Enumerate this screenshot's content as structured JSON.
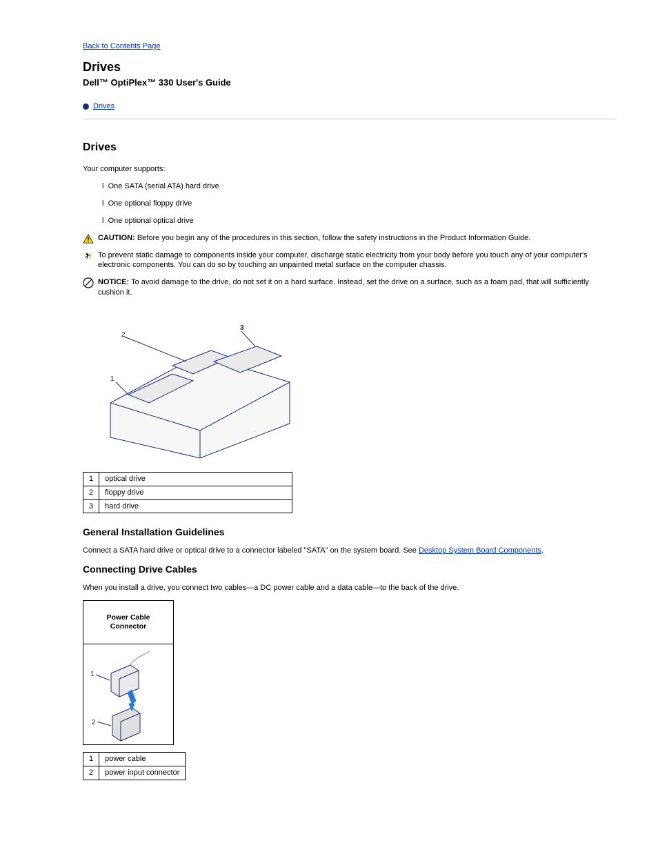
{
  "nav": {
    "back_label": "Back to Contents Page"
  },
  "header": {
    "title": "Drives",
    "manual": "Dell™ OptiPlex™ 330 User's Guide"
  },
  "toc": {
    "item1": "Drives"
  },
  "section": {
    "heading": "Drives"
  },
  "intro": {
    "p1": "Your computer supports:",
    "li1": "One SATA (serial ATA) hard drive",
    "li2": "One optional floppy drive",
    "li3": "One optional optical drive"
  },
  "diagram1": {
    "callouts": {
      "c1": {
        "num": "1",
        "label": "optical drive"
      },
      "c2": {
        "num": "2",
        "label": "floppy drive"
      },
      "c3": {
        "num": "3",
        "label": "hard drive"
      }
    }
  },
  "guidelines": {
    "heading": "General Installation Guidelines",
    "body_pre": "Connect a SATA hard drive or optical drive to a connector labeled \"SATA\" on the system board. See ",
    "link": "Desktop System Board Components",
    "body_post": "."
  },
  "cables": {
    "heading": "Connecting Drive Cables",
    "p1": "When you install a drive, you connect two cables—a DC power cable and a data cable—to the back of the drive."
  },
  "power_conn": {
    "heading": "Power Cable Connector",
    "callouts": {
      "c1": {
        "num": "1",
        "label": "power cable"
      },
      "c2": {
        "num": "2",
        "label": "power input connector"
      }
    }
  },
  "warning": {
    "label": "CAUTION:",
    "text": "Before you begin any of the procedures in this section, follow the safety instructions in the Product Information Guide."
  },
  "static_notice": {
    "text": "To prevent static damage to components inside your computer, discharge static electricity from your body before you touch any of your computer's electronic components. You can do so by touching an unpainted metal surface on the computer chassis."
  },
  "notice": {
    "label": "NOTICE:",
    "text": "To avoid damage to the drive, do not set it on a hard surface. Instead, set the drive on a surface, such as a foam pad, that will sufficiently cushion it."
  }
}
